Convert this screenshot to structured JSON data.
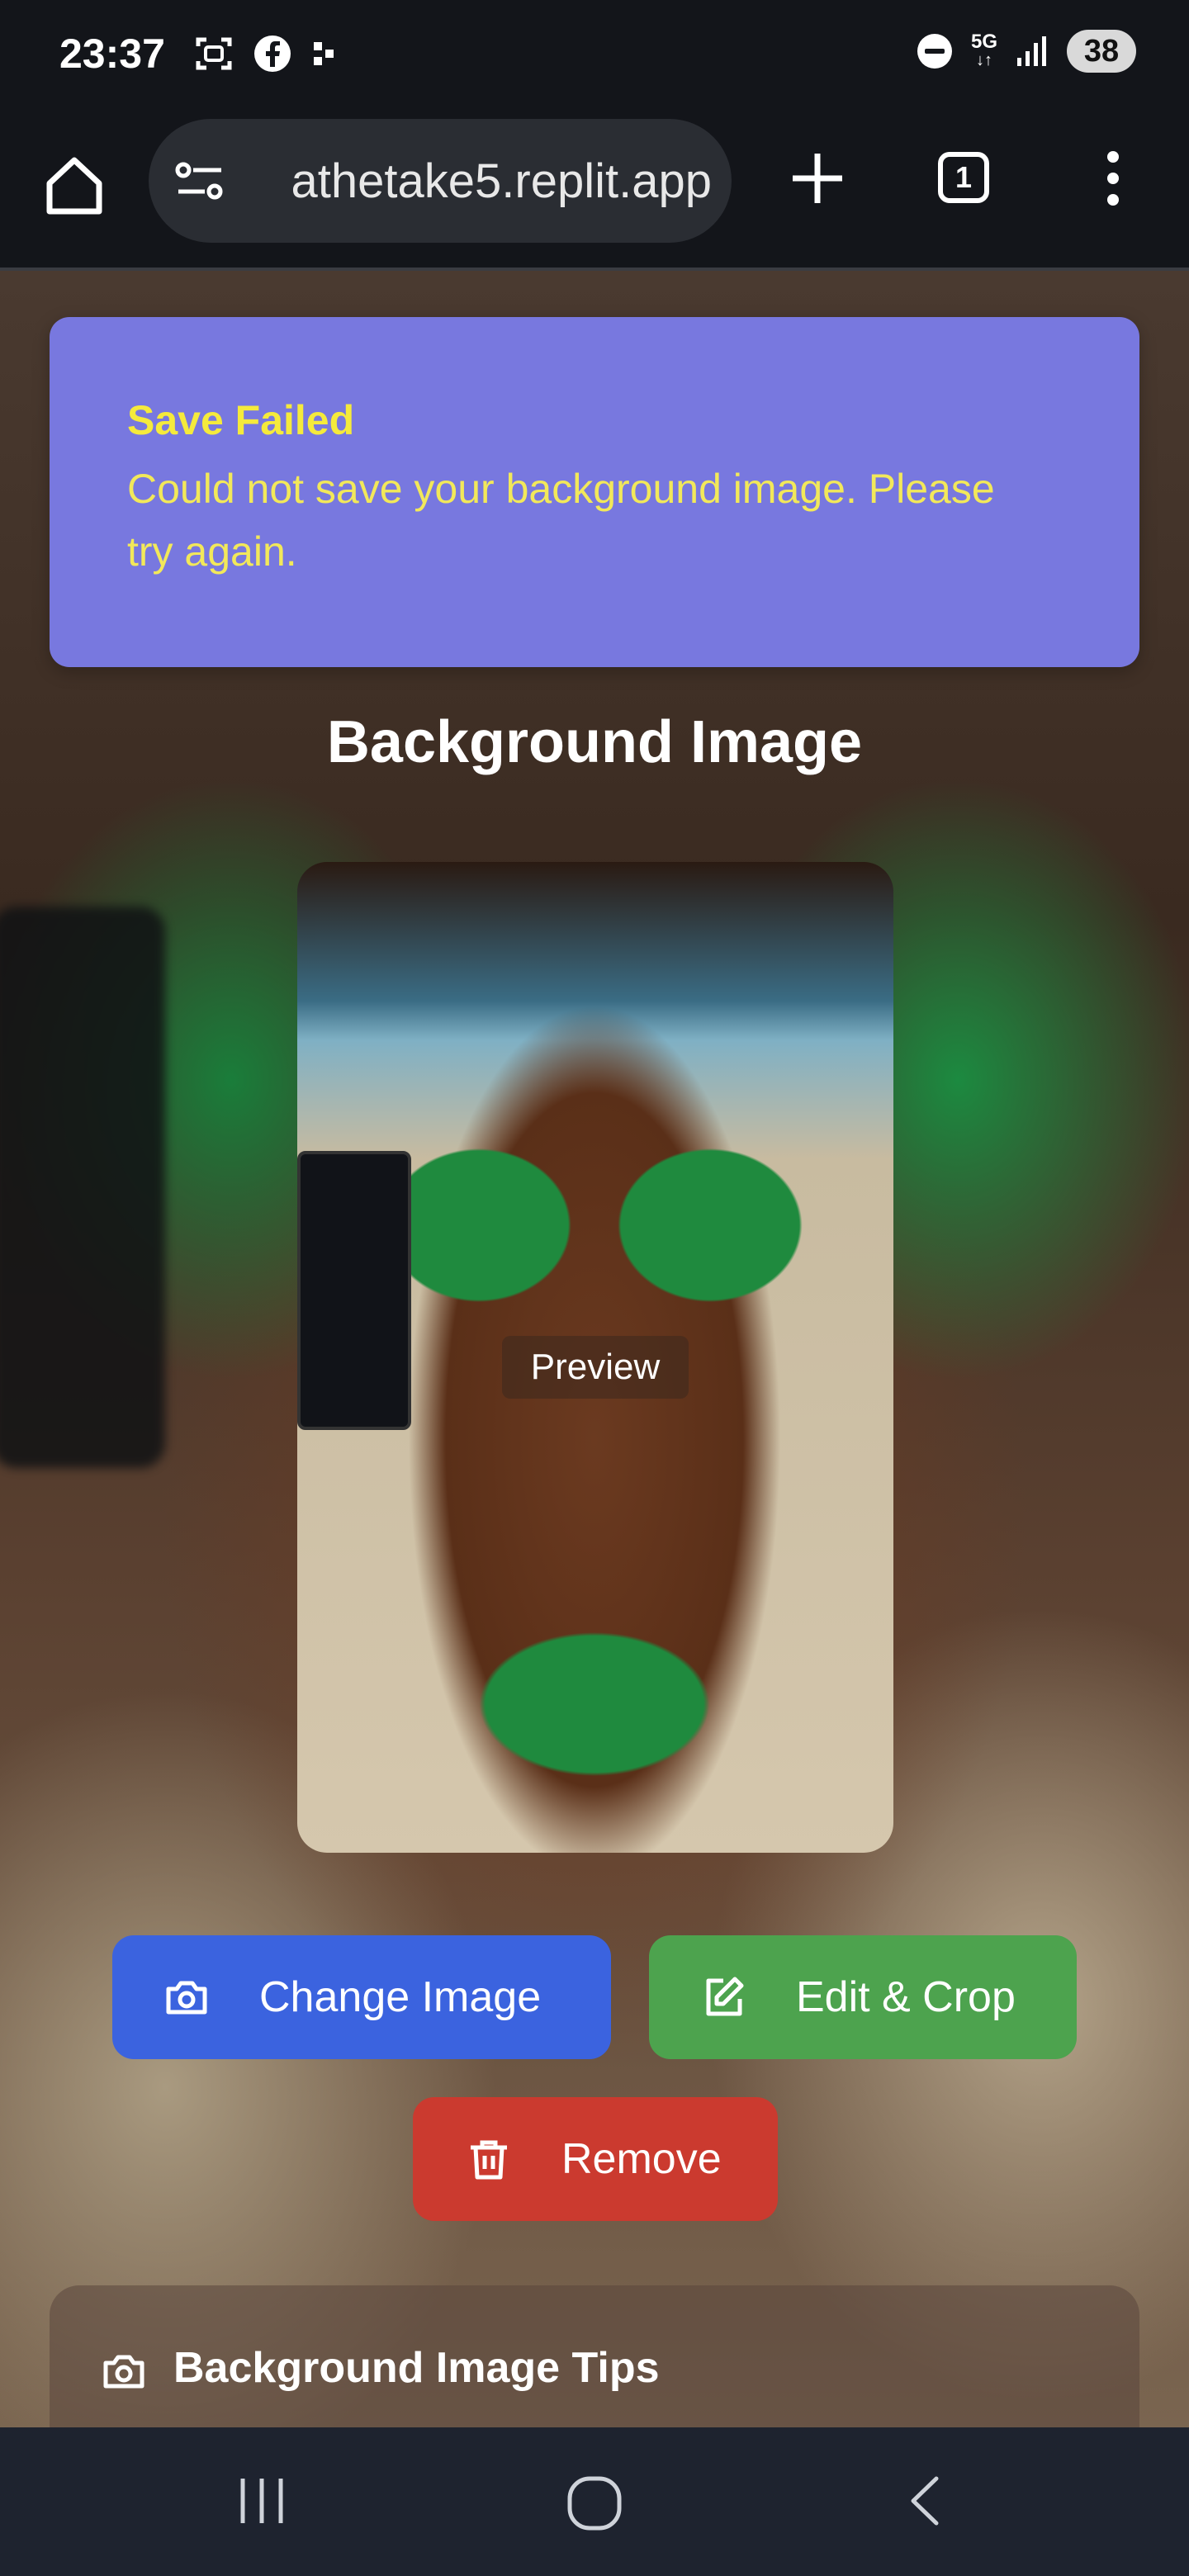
{
  "status_bar": {
    "time": "23:37",
    "left_icons": [
      "screenshot-icon",
      "facebook-icon",
      "dots-icon"
    ],
    "right_icons": [
      "dnd-icon",
      "5g-icon",
      "signal-icon"
    ],
    "network_label": "5G",
    "battery": "38"
  },
  "browser": {
    "url": "athetake5.replit.app",
    "tab_count": "1",
    "icons": [
      "home-icon",
      "site-settings-icon",
      "new-tab-icon",
      "tabs-icon",
      "menu-icon"
    ]
  },
  "toast": {
    "title": "Save Failed",
    "message": "Could not save your background image. Please try again.",
    "bg_color": "#7878df",
    "text_color": "#f5ea3c"
  },
  "main": {
    "section_title": "Background Image",
    "preview_label": "Preview",
    "buttons": {
      "change": "Change Image",
      "edit": "Edit & Crop",
      "remove": "Remove"
    },
    "button_colors": {
      "change": "#3b63df",
      "edit": "#4da34e",
      "remove": "#cb3a2f"
    },
    "tips_title": "Background Image Tips"
  },
  "nav_bar": {
    "icons": [
      "recents-icon",
      "home-circle-icon",
      "back-icon"
    ]
  }
}
